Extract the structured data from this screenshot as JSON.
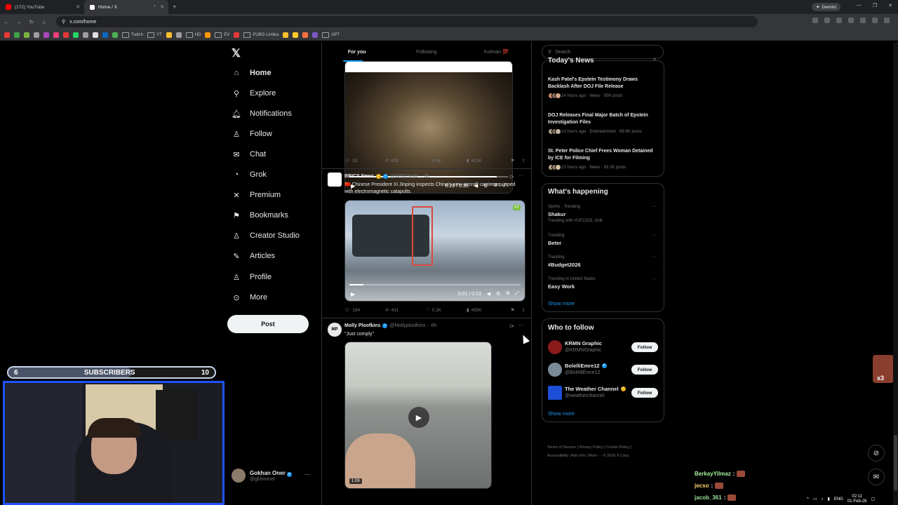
{
  "browser": {
    "tabs": [
      {
        "title": "(172) YouTube",
        "favicon_color": "#ff0000"
      },
      {
        "title": "Home / X",
        "favicon_color": "#ffffff"
      }
    ],
    "gemini_label": "Gemini",
    "url": "x.com/home",
    "bookmarks": [
      "Twitch",
      "YT",
      "HD",
      "EV",
      "PUBG Limbra",
      "APT"
    ]
  },
  "nav": {
    "items": [
      {
        "label": "Home",
        "icon": "home-icon",
        "glyph": "⌂"
      },
      {
        "label": "Explore",
        "icon": "search-icon",
        "glyph": "⌕"
      },
      {
        "label": "Notifications",
        "icon": "bell-icon",
        "glyph": "♫"
      },
      {
        "label": "Follow",
        "icon": "follow-icon",
        "glyph": "☺"
      },
      {
        "label": "Chat",
        "icon": "mail-icon",
        "glyph": "✉"
      },
      {
        "label": "Grok",
        "icon": "grok-icon",
        "glyph": "◔"
      },
      {
        "label": "Premium",
        "icon": "x-premium-icon",
        "glyph": "✕"
      },
      {
        "label": "Bookmarks",
        "icon": "bookmark-icon",
        "glyph": "⚑"
      },
      {
        "label": "Creator Studio",
        "icon": "creator-icon",
        "glyph": "♙"
      },
      {
        "label": "Articles",
        "icon": "articles-icon",
        "glyph": "✎"
      },
      {
        "label": "Profile",
        "icon": "profile-icon",
        "glyph": "♙"
      },
      {
        "label": "More",
        "icon": "more-circle-icon",
        "glyph": "⊙"
      }
    ],
    "post_label": "Post",
    "account": {
      "name": "Gokhan Oner",
      "handle": "@gkhnoner"
    }
  },
  "timeline": {
    "tabs": [
      "For you",
      "Following",
      "Kutman 💯"
    ],
    "tweet1": {
      "time": "0:28 / 0:30",
      "progress": 0.93,
      "stats": {
        "replies": "33",
        "reposts": "835",
        "likes": "9.9K",
        "views": "413K"
      }
    },
    "tweet2": {
      "name": "BRICS News",
      "handle": "@BRICSinfo",
      "age": "3h",
      "text": "🇨🇳 Chinese President Xi Jinping inspects China's new aircraft carrier equipped with electromagnetic catapults.",
      "time": "0:01 / 0:13",
      "progress": 0.08,
      "video_badge": "RT",
      "stats": {
        "replies": "194",
        "reposts": "431",
        "likes": "5.2K",
        "views": "459K"
      }
    },
    "tweet3": {
      "name": "Molly Ploofkins",
      "handle": "@Mollyploofkins",
      "age": "6h",
      "text": "\"Just comply\"",
      "duration": "1:09",
      "avatar_text": "MP"
    }
  },
  "sidebar": {
    "search_placeholder": "Search",
    "news_title": "Today's News",
    "news": [
      {
        "title": "Kash Patel's Epstein Testimony Draws Backlash After DOJ File Release",
        "meta": "14 hours ago · News · 50K posts"
      },
      {
        "title": "DOJ Releases Final Major Batch of Epstein Investigation Files",
        "meta": "10 hours ago · Entertainment · 69.9K posts"
      },
      {
        "title": "St. Peter Police Chief Frees Woman Detained by ICE for Filming",
        "meta": "13 hours ago · News · 63.3K posts"
      }
    ],
    "happening_title": "What's happening",
    "trends": [
      {
        "category": "Sports · Trending",
        "name": "Shakur",
        "extra": "Trending with #UFC325, Volk"
      },
      {
        "category": "Trending",
        "name": "Beter"
      },
      {
        "category": "Trending",
        "name": "#Budget2026"
      },
      {
        "category": "Trending in United States",
        "name": "Easy Work"
      }
    ],
    "show_more": "Show more",
    "wtf_title": "Who to follow",
    "who_to_follow": [
      {
        "name": "KRMN Graphic",
        "handle": "@KRMNGraphic",
        "color": "#8b1a1a"
      },
      {
        "name": "BolelliEmre12",
        "handle": "@BolelliEmre12",
        "color": "#7a8a99"
      },
      {
        "name": "The Weather Channel",
        "handle": "@weatherchannel",
        "color": "#1d4ed8"
      }
    ],
    "follow_label": "Follow",
    "footer_line1": "Terms of Service | Privacy Policy | Cookie Policy |",
    "footer_line2": "Accessibility | Ads info | More ··· © 2026 X Corp."
  },
  "stream": {
    "subs_current": "6",
    "subs_label": "SUBSCRIBERS",
    "subs_goal": "10",
    "subs_progress": 0.6,
    "emote_count": "x3",
    "chat": [
      {
        "user": "BerkayYilmaz",
        "color": "#a7f3a0"
      },
      {
        "user": "jecso",
        "color": "#ffd86b"
      },
      {
        "user": "jacob_361",
        "color": "#9be59b"
      }
    ]
  },
  "taskbar": {
    "lang": "ENG",
    "time": "02:11",
    "date": "01-Feb-26"
  }
}
